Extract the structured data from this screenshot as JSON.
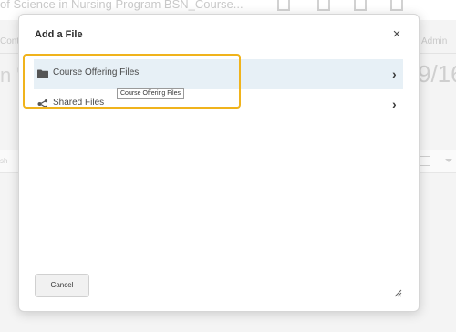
{
  "background": {
    "page_title": "of Science in Nursing Program BSN_Course...",
    "nav_left": "Cont",
    "nav_right": "Admin",
    "big_left": "n \"",
    "big_right": "9/16",
    "bar_left": "sh"
  },
  "dialog": {
    "title": "Add a File",
    "close_glyph": "×",
    "rows": [
      {
        "label": "Course Offering Files",
        "icon": "folder-icon",
        "chevron": "›"
      },
      {
        "label": "Shared Files",
        "icon": "share-icon",
        "chevron": "›"
      }
    ],
    "tooltip": "Course Offering Files",
    "cancel_label": "Cancel"
  },
  "colors": {
    "highlight": "#f0b31c",
    "selected_row": "#e7f0f6"
  }
}
